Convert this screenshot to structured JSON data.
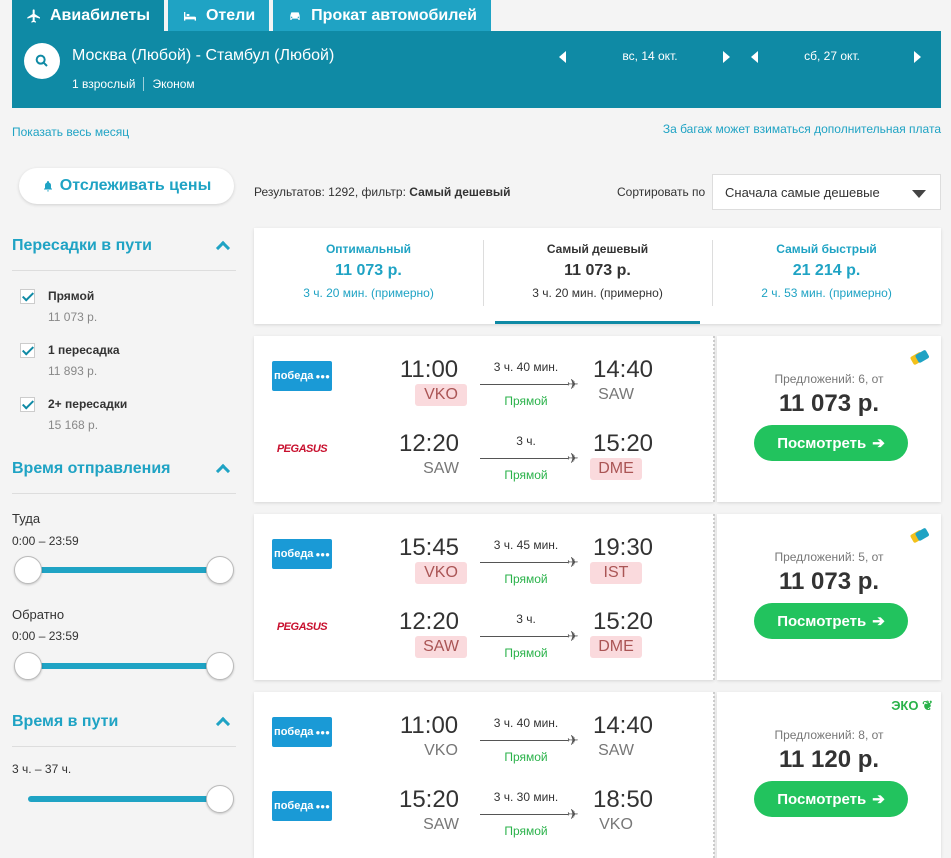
{
  "tabs": [
    {
      "label": "Авиабилеты",
      "icon": "plane-icon"
    },
    {
      "label": "Отели",
      "icon": "bed-icon"
    },
    {
      "label": "Прокат автомобилей",
      "icon": "car-icon"
    }
  ],
  "search": {
    "route": "Москва (Любой) - Стамбул (Любой)",
    "passengers": "1 взрослый",
    "cabin": "Эконом",
    "date_out": "вс, 14 окт.",
    "date_back": "сб, 27 окт."
  },
  "links": {
    "show_month": "Показать весь месяц",
    "baggage_note": "За багаж может взиматься дополнительная плата"
  },
  "track_prices": "Отслеживать цены",
  "filters": {
    "stops": {
      "title": "Пересадки в пути",
      "items": [
        {
          "label": "Прямой",
          "price": "11 073 р."
        },
        {
          "label": "1 пересадка",
          "price": "11 893 р."
        },
        {
          "label": "2+ пересадки",
          "price": "15 168 р."
        }
      ]
    },
    "departure": {
      "title": "Время отправления",
      "out_label": "Туда",
      "out_range": "0:00 – 23:59",
      "back_label": "Обратно",
      "back_range": "0:00 – 23:59"
    },
    "duration": {
      "title": "Время в пути",
      "range": "3 ч. – 37 ч."
    }
  },
  "results": {
    "prefix": "Результатов: 1292, фильтр: ",
    "filter": "Самый дешевый",
    "sort_label": "Сортировать по",
    "sort_value": "Сначала самые дешевые"
  },
  "sort_tabs": [
    {
      "title": "Оптимальный",
      "price": "11 073 р.",
      "duration": "3 ч. 20 мин. (примерно)"
    },
    {
      "title": "Самый дешевый",
      "price": "11 073 р.",
      "duration": "3 ч. 20 мин. (примерно)"
    },
    {
      "title": "Самый быстрый",
      "price": "21 214 р.",
      "duration": "2 ч. 53 мин. (примерно)"
    }
  ],
  "logos": {
    "pobeda": "победа",
    "pegasus": "PEGASUS"
  },
  "offers_prefix": "Предложений: ",
  "offers_suffix": ", от",
  "view_button": "Посмотреть",
  "eko_label": "ЭКО",
  "flights": [
    {
      "offers": "6",
      "price": "11 073 р.",
      "badge": "luggage",
      "legs": [
        {
          "airline": "pobeda",
          "dep": "11:00",
          "dep_ap": "VKO",
          "dep_hl": true,
          "dur": "3 ч. 40 мин.",
          "stop": "Прямой",
          "arr": "14:40",
          "arr_ap": "SAW",
          "arr_hl": false
        },
        {
          "airline": "pegasus",
          "dep": "12:20",
          "dep_ap": "SAW",
          "dep_hl": false,
          "dur": "3 ч.",
          "stop": "Прямой",
          "arr": "15:20",
          "arr_ap": "DME",
          "arr_hl": true
        }
      ]
    },
    {
      "offers": "5",
      "price": "11 073 р.",
      "badge": "luggage",
      "legs": [
        {
          "airline": "pobeda",
          "dep": "15:45",
          "dep_ap": "VKO",
          "dep_hl": true,
          "dur": "3 ч. 45 мин.",
          "stop": "Прямой",
          "arr": "19:30",
          "arr_ap": "IST",
          "arr_hl": true
        },
        {
          "airline": "pegasus",
          "dep": "12:20",
          "dep_ap": "SAW",
          "dep_hl": true,
          "dur": "3 ч.",
          "stop": "Прямой",
          "arr": "15:20",
          "arr_ap": "DME",
          "arr_hl": true
        }
      ]
    },
    {
      "offers": "8",
      "price": "11 120 р.",
      "badge": "eko",
      "legs": [
        {
          "airline": "pobeda",
          "dep": "11:00",
          "dep_ap": "VKO",
          "dep_hl": false,
          "dur": "3 ч. 40 мин.",
          "stop": "Прямой",
          "arr": "14:40",
          "arr_ap": "SAW",
          "arr_hl": false
        },
        {
          "airline": "pobeda",
          "dep": "15:20",
          "dep_ap": "SAW",
          "dep_hl": false,
          "dur": "3 ч. 30 мин.",
          "stop": "Прямой",
          "arr": "18:50",
          "arr_ap": "VKO",
          "arr_hl": false
        }
      ]
    }
  ],
  "colors": {
    "brand": "#0f8aa5",
    "accent": "#1fa3c4",
    "cta": "#22c35e",
    "direct": "#2ab24a",
    "highlight": "#fadadd"
  }
}
